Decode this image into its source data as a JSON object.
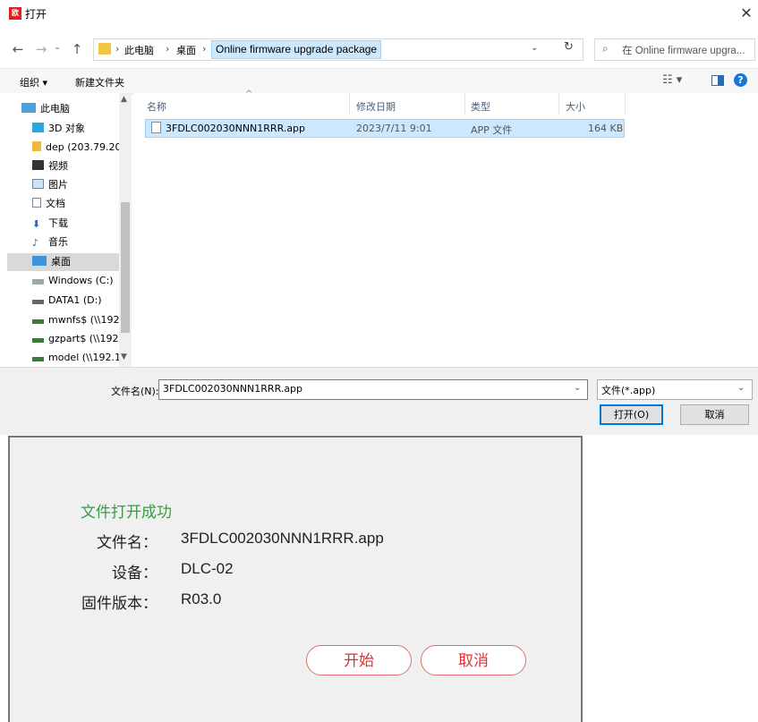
{
  "window": {
    "title": "打开",
    "app_icon_text": "欧"
  },
  "address_bar": {
    "crumbs": [
      "此电脑",
      "桌面"
    ],
    "current": "Online firmware upgrade package",
    "search_placeholder": "在 Online firmware upgra..."
  },
  "toolbar": {
    "organize": "组织 ▾",
    "new_folder": "新建文件夹"
  },
  "nav_pane": {
    "items": [
      {
        "label": "此电脑",
        "icon": "computer-icon"
      },
      {
        "label": "3D 对象",
        "icon": "3d-objects-icon"
      },
      {
        "label": "dep (203.79.20",
        "icon": "user-folder-icon"
      },
      {
        "label": "视频",
        "icon": "video-icon"
      },
      {
        "label": "图片",
        "icon": "picture-icon"
      },
      {
        "label": "文档",
        "icon": "document-icon"
      },
      {
        "label": "下载",
        "icon": "download-icon"
      },
      {
        "label": "音乐",
        "icon": "music-icon"
      },
      {
        "label": "桌面",
        "icon": "desktop-icon",
        "selected": true
      },
      {
        "label": "Windows (C:)",
        "icon": "windows-drive-icon"
      },
      {
        "label": "DATA1 (D:)",
        "icon": "drive-icon"
      },
      {
        "label": "mwnfs$ (\\\\192.",
        "icon": "network-drive-icon"
      },
      {
        "label": "gzpart$ (\\\\192.",
        "icon": "network-drive-icon"
      },
      {
        "label": "model (\\\\192.1",
        "icon": "network-drive-icon"
      }
    ]
  },
  "file_list": {
    "columns": [
      "名称",
      "修改日期",
      "类型",
      "大小"
    ],
    "rows": [
      {
        "name": "3FDLC002030NNN1RRR.app",
        "modified": "2023/7/11 9:01",
        "type": "APP 文件",
        "size": "164 KB"
      }
    ]
  },
  "footer": {
    "filename_label": "文件名(N):",
    "filename_value": "3FDLC002030NNN1RRR.app",
    "filter_value": "文件(*.app)",
    "open_label": "打开(O)",
    "cancel_label": "取消"
  },
  "panel": {
    "message": "文件打开成功",
    "fields": [
      {
        "label": "文件名：",
        "value": "3FDLC002030NNN1RRR.app"
      },
      {
        "label": "设备：",
        "value": "DLC-02"
      },
      {
        "label": "固件版本：",
        "value": "R03.0"
      }
    ],
    "start_label": "开始",
    "cancel_label": "取消"
  },
  "colors": {
    "selection": "#cce8ff",
    "accent": "#0078d7",
    "success": "#3a9a46",
    "pill": "#e03030"
  }
}
